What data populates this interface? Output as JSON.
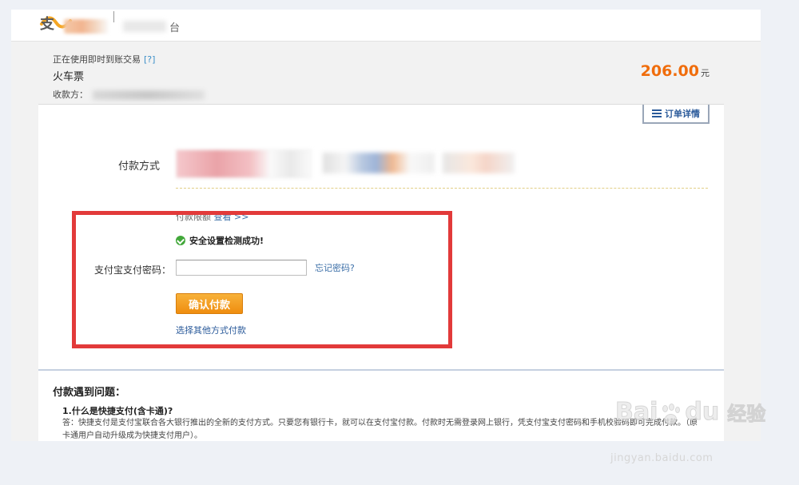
{
  "header": {
    "title": "台"
  },
  "order": {
    "mode_text": "正在使用即时到账交易",
    "help_link": "[?]",
    "product": "火车票",
    "payee_label": "收款方："
  },
  "amount": {
    "value": "206.00",
    "unit": "元"
  },
  "order_detail_button": "订单详情",
  "payment": {
    "method_label": "付款方式",
    "limit_text": "付款限额",
    "limit_link": "查看 >>",
    "security_check": "安全设置检测成功!",
    "password_label": "支付宝支付密码：",
    "password_value": "",
    "forgot_password": "忘记密码?",
    "confirm_button": "确认付款",
    "other_method": "选择其他方式付款"
  },
  "faq": {
    "title": "付款遇到问题：",
    "q1": "1.什么是快捷支付(含卡通)?",
    "a1": "答：快捷支付是支付宝联合各大银行推出的全新的支付方式。只要您有银行卡，就可以在支付宝付款。付款时无需登录网上银行，凭支付宝支付密码和手机校验码即可完成付款。（原卡通用户自动升级成为快捷支付用户）。"
  },
  "watermark": {
    "brand_left": "Bai",
    "brand_right": "du",
    "brand_cn": "经验",
    "url": "jingyan.baidu.com"
  },
  "colors": {
    "amount": "#f06d0c",
    "confirm_button": "#f5a023",
    "highlight_box": "#e23a3a",
    "link": "#3c6fa8"
  }
}
